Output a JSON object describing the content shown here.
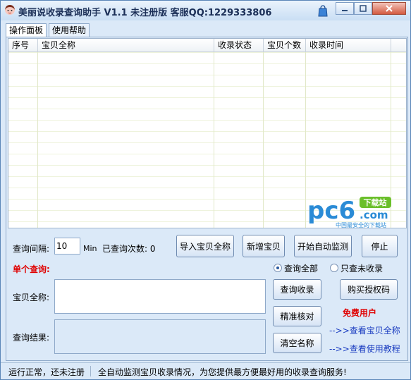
{
  "window": {
    "title": "美丽说收录查询助手 V1.1 未注册版  客服QQ:1229333806",
    "icon": "girl-avatar-icon",
    "extra_icon": "shopping-bag-icon",
    "controls": [
      "minimize-icon",
      "maximize-icon",
      "close-icon"
    ]
  },
  "tabs": [
    {
      "label": "操作面板",
      "active": true
    },
    {
      "label": "使用帮助",
      "active": false
    }
  ],
  "table": {
    "columns": [
      "序号",
      "宝贝全称",
      "收录状态",
      "宝贝个数",
      "收录时间"
    ],
    "rows": []
  },
  "watermark": {
    "logo_text": "pc6",
    "dot_com": ".com",
    "download_badge": "下载站",
    "slogan": "中国最安全的下载站"
  },
  "controls": {
    "interval_label": "查询间隔:",
    "interval_value": "10",
    "interval_unit": "Min",
    "count_label": "已查询次数: 0",
    "import_button": "导入宝贝全称",
    "add_button": "新增宝贝",
    "start_button": "开始自动监测",
    "stop_button": "停止",
    "single_query_label": "单个查询:",
    "radio_all": "查询全部",
    "radio_unindexed": "只查未收录",
    "radio_selected": "all",
    "item_name_label": "宝贝全称:",
    "item_name_value": "",
    "result_label": "查询结果:",
    "result_value": "",
    "query_button": "查询收录",
    "buy_button": "购买授权码",
    "verify_button": "精准核对",
    "clear_button": "清空名称",
    "free_user": "免费用户",
    "link_view_items": "-->>查看宝贝全称",
    "link_tutorial": "-->>查看使用教程"
  },
  "statusbar": {
    "status": "运行正常，还未注册",
    "message": "全自动监测宝贝收录情况，为您提供最方便最好用的收录查询服务!"
  },
  "colors": {
    "window_bg": "#dbe9f8",
    "title_text": "#1b2f57",
    "accent_red": "#e00000",
    "link_blue": "#1a3cc0",
    "watermark_blue": "#2a8bd6",
    "watermark_green": "#6abf2a"
  }
}
